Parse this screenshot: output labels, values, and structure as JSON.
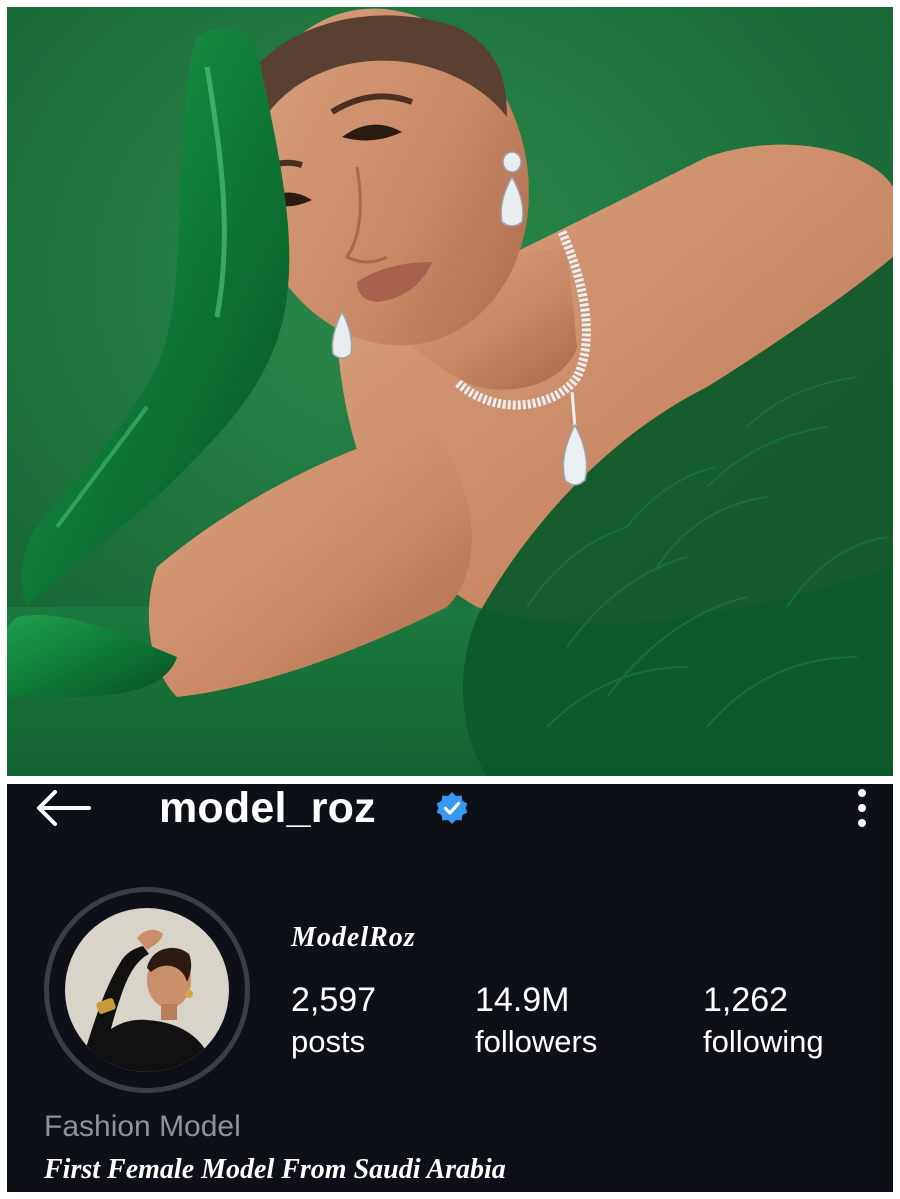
{
  "photo": {
    "description_icon": "portrait-photo",
    "background_color": "#1f7a3e"
  },
  "profile": {
    "username": "model_roz",
    "verified_icon": "verified-badge-icon",
    "back_icon": "arrow-left-icon",
    "more_icon": "more-vertical-icon",
    "display_name": "ModelRoz",
    "stats": [
      {
        "value": "2,597",
        "label": "posts"
      },
      {
        "value": "14.9M",
        "label": "followers"
      },
      {
        "value": "1,262",
        "label": "following"
      }
    ],
    "category": "Fashion Model",
    "bio": "First Female Model From Saudi Arabia",
    "colors": {
      "background": "#0d1117",
      "verified": "#3897f0",
      "category_text": "#8e929a",
      "avatar_ring": "#3a3f47"
    }
  }
}
